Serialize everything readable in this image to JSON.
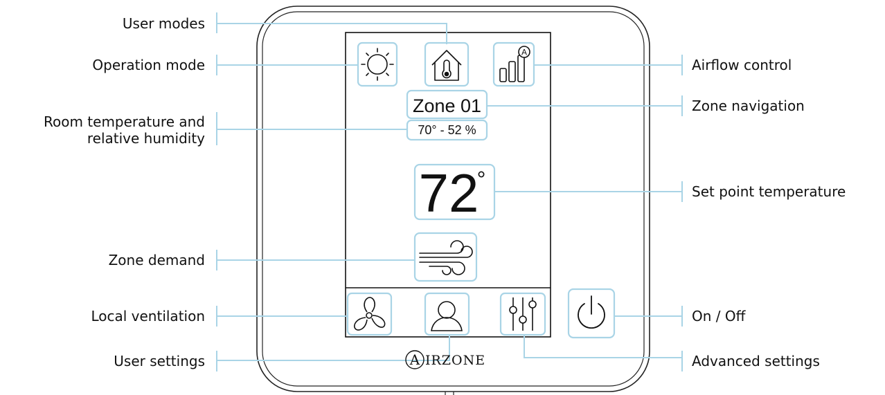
{
  "device": {
    "zone_name": "Zone 01",
    "room_reading": "70° - 52 %",
    "setpoint_value": "72",
    "setpoint_unit": "°",
    "brand": "IRZONE",
    "brand_initial": "A"
  },
  "callouts": {
    "user_modes": "User modes",
    "operation_mode": "Operation mode",
    "room_temp_line1": "Room temperature and",
    "room_temp_line2": "relative humidity",
    "zone_demand": "Zone demand",
    "local_ventilation": "Local ventilation",
    "user_settings": "User settings",
    "airflow_control": "Airflow control",
    "zone_navigation": "Zone navigation",
    "set_point": "Set point temperature",
    "on_off": "On / Off",
    "advanced_settings": "Advanced settings"
  },
  "colors": {
    "callout_line": "#a9d4e6",
    "highlight_box": "#a9d4e6",
    "outline": "#111111"
  },
  "icons": [
    "sun-icon",
    "home-thermometer-icon",
    "airflow-bars-icon",
    "wind-icon",
    "fan-icon",
    "user-icon",
    "sliders-icon",
    "power-icon"
  ]
}
